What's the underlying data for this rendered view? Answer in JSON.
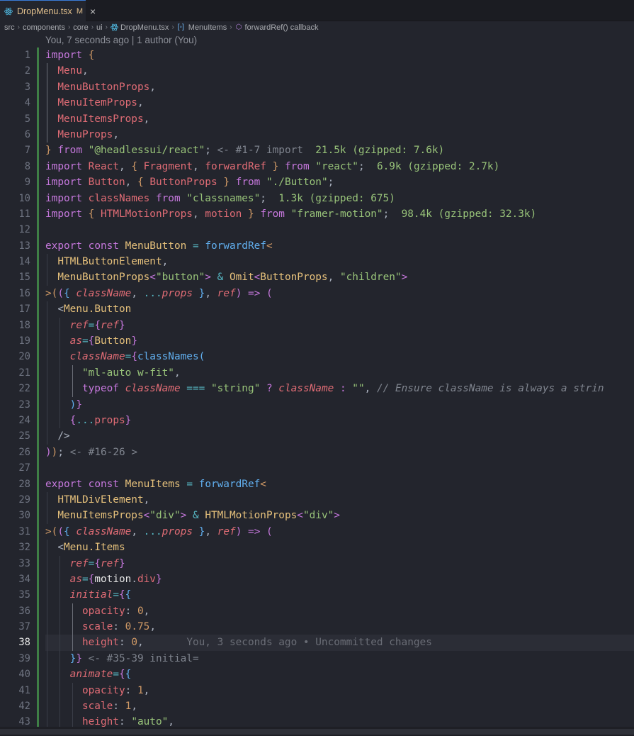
{
  "tab": {
    "filename": "DropMenu.tsx",
    "status": "M",
    "close": "×",
    "icon": "react-icon"
  },
  "breadcrumb": {
    "items": [
      "src",
      "components",
      "core",
      "ui",
      "DropMenu.tsx",
      "MenuItems",
      "forwardRef() callback"
    ],
    "icons": [
      "",
      "",
      "",
      "",
      "react-icon",
      "module-icon",
      "function-icon"
    ]
  },
  "codelens": "You, 7 seconds ago | 1 author (You)",
  "current_line": 38,
  "line_numbers": [
    "1",
    "2",
    "3",
    "4",
    "5",
    "6",
    "7",
    "8",
    "9",
    "10",
    "11",
    "12",
    "13",
    "14",
    "15",
    "16",
    "17",
    "18",
    "19",
    "20",
    "21",
    "22",
    "23",
    "24",
    "25",
    "26",
    "27",
    "28",
    "29",
    "30",
    "31",
    "32",
    "33",
    "34",
    "35",
    "36",
    "37",
    "38",
    "39",
    "40",
    "41",
    "42",
    "43"
  ],
  "colors": {
    "accent": "#3a7bd5",
    "modified": "#e2c08d",
    "background": "#23252d",
    "added_gutter": "#3f7f46"
  },
  "inline_annotations": {
    "import_fold": "<- #1-7 import",
    "headlessui_size": "21.5k (gzipped: 7.6k)",
    "react_size": "6.9k (gzipped: 2.7k)",
    "classnames_size": "1.3k (gzipped: 675)",
    "framer_size": "98.4k (gzipped: 32.3k)",
    "fold_16_26": "<- #16-26 >",
    "fold_35_39": "<- #35-39 initial=",
    "blame_38": "You, 3 seconds ago • Uncommitted changes"
  },
  "comment_22": "// Ensure className is always a strin"
}
